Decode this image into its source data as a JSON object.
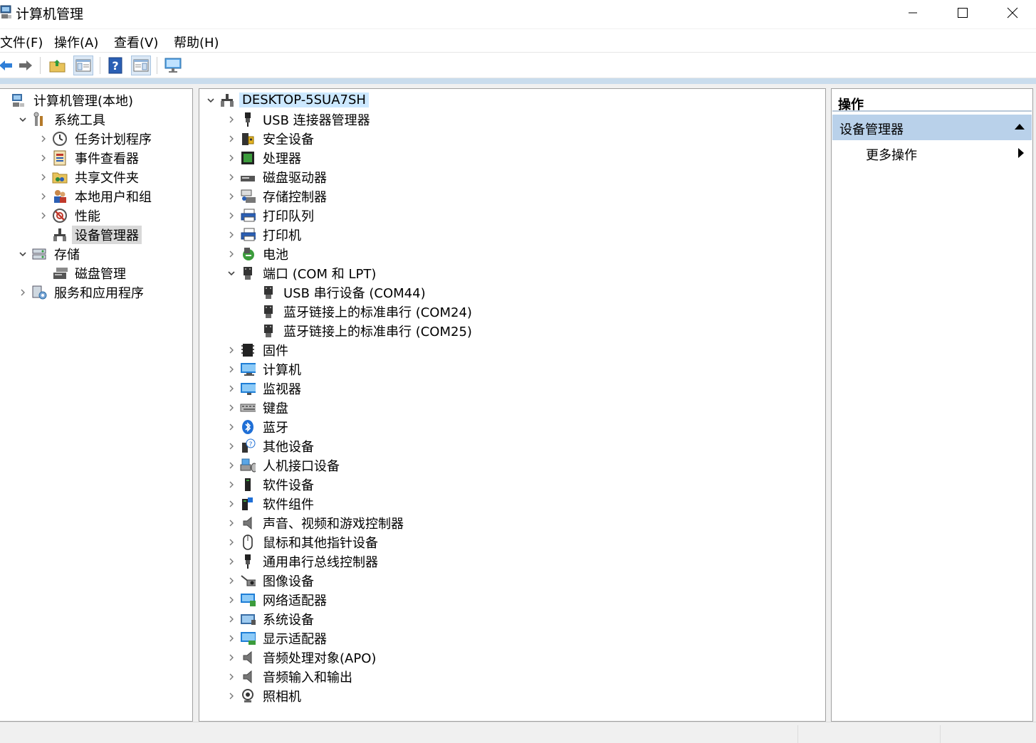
{
  "window": {
    "title": "计算机管理"
  },
  "menu": [
    "文件(F)",
    "操作(A)",
    "查看(V)",
    "帮助(H)"
  ],
  "toolbar": [
    "back-icon",
    "forward-icon",
    "up-folder-icon",
    "show-hide-tree-icon",
    "help-icon",
    "show-hide-action-pane-icon",
    "monitor-icon"
  ],
  "left_tree": [
    {
      "label": "计算机管理(本地)",
      "level": 0,
      "chevron": "none",
      "icon": "computer-management-icon"
    },
    {
      "label": "系统工具",
      "level": 1,
      "chevron": "down",
      "icon": "system-tools-icon"
    },
    {
      "label": "任务计划程序",
      "level": 2,
      "chevron": "right",
      "icon": "task-scheduler-icon"
    },
    {
      "label": "事件查看器",
      "level": 2,
      "chevron": "right",
      "icon": "event-viewer-icon"
    },
    {
      "label": "共享文件夹",
      "level": 2,
      "chevron": "right",
      "icon": "shared-folders-icon"
    },
    {
      "label": "本地用户和组",
      "level": 2,
      "chevron": "right",
      "icon": "local-users-icon"
    },
    {
      "label": "性能",
      "level": 2,
      "chevron": "right",
      "icon": "performance-icon"
    },
    {
      "label": "设备管理器",
      "level": 2,
      "chevron": "none",
      "icon": "device-manager-icon",
      "selected": true
    },
    {
      "label": "存储",
      "level": 1,
      "chevron": "down",
      "icon": "storage-icon"
    },
    {
      "label": "磁盘管理",
      "level": 2,
      "chevron": "none",
      "icon": "disk-management-icon"
    },
    {
      "label": "服务和应用程序",
      "level": 1,
      "chevron": "right",
      "icon": "services-icon"
    }
  ],
  "device_tree": [
    {
      "label": "DESKTOP-5SUA7SH",
      "level": 0,
      "chevron": "down",
      "icon": "computer-root-icon",
      "selected": true
    },
    {
      "label": "USB 连接器管理器",
      "level": 1,
      "chevron": "right",
      "icon": "usb-icon"
    },
    {
      "label": "安全设备",
      "level": 1,
      "chevron": "right",
      "icon": "security-device-icon"
    },
    {
      "label": "处理器",
      "level": 1,
      "chevron": "right",
      "icon": "processor-icon"
    },
    {
      "label": "磁盘驱动器",
      "level": 1,
      "chevron": "right",
      "icon": "disk-drive-icon"
    },
    {
      "label": "存储控制器",
      "level": 1,
      "chevron": "right",
      "icon": "storage-controller-icon"
    },
    {
      "label": "打印队列",
      "level": 1,
      "chevron": "right",
      "icon": "printer-icon"
    },
    {
      "label": "打印机",
      "level": 1,
      "chevron": "right",
      "icon": "printer-icon"
    },
    {
      "label": "电池",
      "level": 1,
      "chevron": "right",
      "icon": "battery-icon"
    },
    {
      "label": "端口 (COM 和 LPT)",
      "level": 1,
      "chevron": "down",
      "icon": "port-icon"
    },
    {
      "label": "USB 串行设备 (COM44)",
      "level": 2,
      "chevron": "none",
      "icon": "port-icon"
    },
    {
      "label": "蓝牙链接上的标准串行 (COM24)",
      "level": 2,
      "chevron": "none",
      "icon": "port-icon"
    },
    {
      "label": "蓝牙链接上的标准串行 (COM25)",
      "level": 2,
      "chevron": "none",
      "icon": "port-icon"
    },
    {
      "label": "固件",
      "level": 1,
      "chevron": "right",
      "icon": "firmware-icon"
    },
    {
      "label": "计算机",
      "level": 1,
      "chevron": "right",
      "icon": "computer-icon"
    },
    {
      "label": "监视器",
      "level": 1,
      "chevron": "right",
      "icon": "monitor-icon"
    },
    {
      "label": "键盘",
      "level": 1,
      "chevron": "right",
      "icon": "keyboard-icon"
    },
    {
      "label": "蓝牙",
      "level": 1,
      "chevron": "right",
      "icon": "bluetooth-icon"
    },
    {
      "label": "其他设备",
      "level": 1,
      "chevron": "right",
      "icon": "other-devices-icon"
    },
    {
      "label": "人机接口设备",
      "level": 1,
      "chevron": "right",
      "icon": "hid-icon"
    },
    {
      "label": "软件设备",
      "level": 1,
      "chevron": "right",
      "icon": "software-device-icon"
    },
    {
      "label": "软件组件",
      "level": 1,
      "chevron": "right",
      "icon": "software-component-icon"
    },
    {
      "label": "声音、视频和游戏控制器",
      "level": 1,
      "chevron": "right",
      "icon": "speaker-icon"
    },
    {
      "label": "鼠标和其他指针设备",
      "level": 1,
      "chevron": "right",
      "icon": "mouse-icon"
    },
    {
      "label": "通用串行总线控制器",
      "level": 1,
      "chevron": "right",
      "icon": "usb-icon"
    },
    {
      "label": "图像设备",
      "level": 1,
      "chevron": "right",
      "icon": "imaging-device-icon"
    },
    {
      "label": "网络适配器",
      "level": 1,
      "chevron": "right",
      "icon": "network-adapter-icon"
    },
    {
      "label": "系统设备",
      "level": 1,
      "chevron": "right",
      "icon": "system-device-icon"
    },
    {
      "label": "显示适配器",
      "level": 1,
      "chevron": "right",
      "icon": "display-adapter-icon"
    },
    {
      "label": "音频处理对象(APO)",
      "level": 1,
      "chevron": "right",
      "icon": "speaker-icon"
    },
    {
      "label": "音频输入和输出",
      "level": 1,
      "chevron": "right",
      "icon": "speaker-icon"
    },
    {
      "label": "照相机",
      "level": 1,
      "chevron": "right",
      "icon": "camera-icon"
    }
  ],
  "actions": {
    "header": "操作",
    "section": "设备管理器",
    "item": "更多操作"
  }
}
